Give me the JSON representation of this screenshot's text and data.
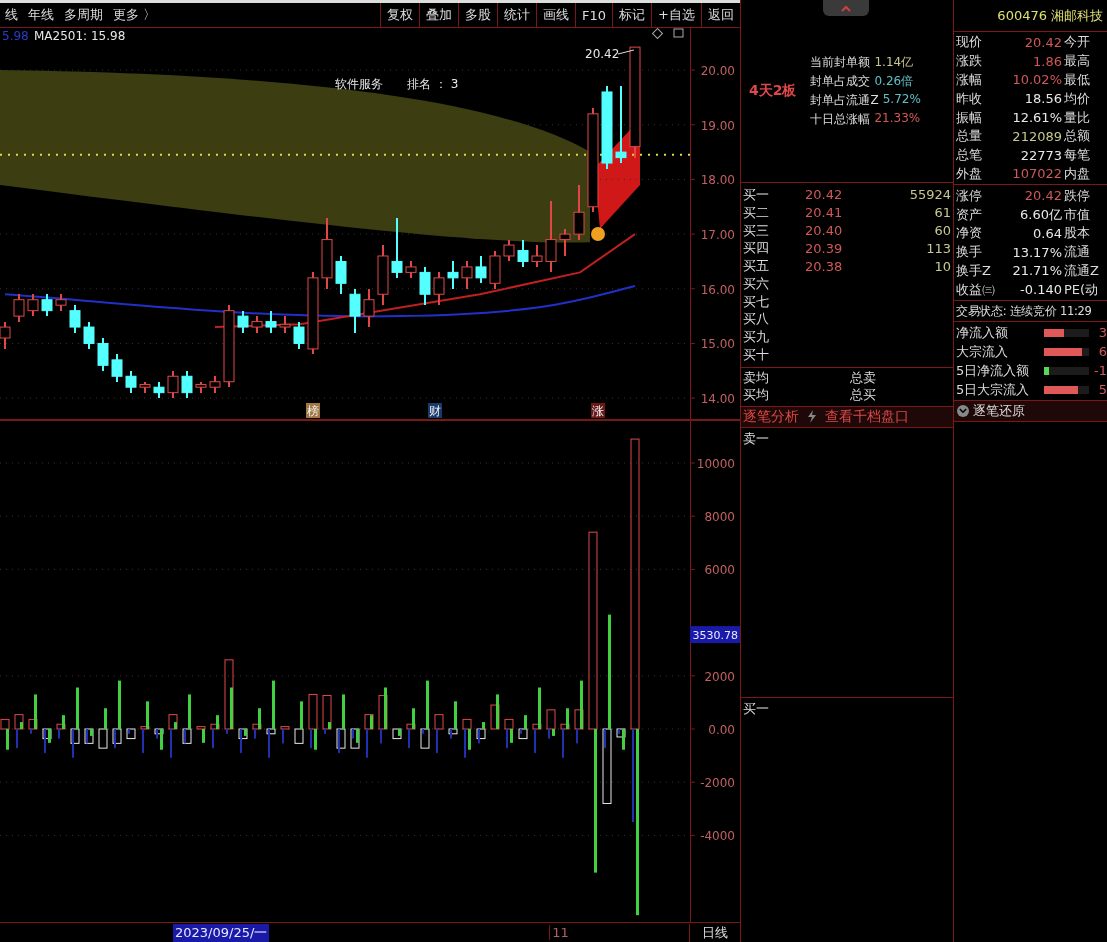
{
  "toolbar": {
    "left": [
      "线",
      "年线",
      "多周期",
      "更多 〉"
    ],
    "right": [
      "复权",
      "叠加",
      "多股",
      "统计",
      "画线",
      "F10",
      "标记",
      "+自选",
      "返回"
    ]
  },
  "price_chart": {
    "legend": [
      {
        "text": "5.98",
        "color": "#2a3cc8"
      },
      {
        "text": "MA2501: 15.98",
        "color": "#e8e8e8"
      }
    ],
    "sector_label": "软件服务",
    "rank_label": "排名 ： 3",
    "last_price_tag": "20.42",
    "chart_data": {
      "type": "candlestick",
      "ylim": [
        13.6,
        20.77
      ],
      "grid": true,
      "ohlc": [
        [
          15.1,
          15.4,
          14.9,
          15.3
        ],
        [
          15.5,
          15.9,
          15.4,
          15.8
        ],
        [
          15.6,
          15.9,
          15.5,
          15.8
        ],
        [
          15.8,
          15.9,
          15.5,
          15.6
        ],
        [
          15.7,
          15.9,
          15.6,
          15.8
        ],
        [
          15.6,
          15.7,
          15.2,
          15.3
        ],
        [
          15.3,
          15.4,
          14.9,
          15.0
        ],
        [
          15.0,
          15.1,
          14.5,
          14.6
        ],
        [
          14.7,
          14.8,
          14.3,
          14.4
        ],
        [
          14.4,
          14.5,
          14.1,
          14.2
        ],
        [
          14.2,
          14.3,
          14.1,
          14.25
        ],
        [
          14.2,
          14.3,
          14.0,
          14.1
        ],
        [
          14.1,
          14.5,
          14.0,
          14.4
        ],
        [
          14.4,
          14.5,
          14.0,
          14.1
        ],
        [
          14.2,
          14.3,
          14.1,
          14.25
        ],
        [
          14.2,
          14.4,
          14.1,
          14.3
        ],
        [
          14.3,
          15.7,
          14.2,
          15.6
        ],
        [
          15.5,
          15.6,
          15.2,
          15.3
        ],
        [
          15.3,
          15.5,
          15.2,
          15.4
        ],
        [
          15.4,
          15.6,
          15.2,
          15.3
        ],
        [
          15.3,
          15.5,
          15.2,
          15.35
        ],
        [
          15.3,
          15.4,
          14.9,
          15.0
        ],
        [
          14.9,
          16.3,
          14.8,
          16.2
        ],
        [
          16.2,
          17.3,
          16.0,
          16.9
        ],
        [
          16.5,
          16.6,
          15.9,
          16.1
        ],
        [
          15.9,
          16.0,
          15.2,
          15.5
        ],
        [
          15.5,
          16.0,
          15.3,
          15.8
        ],
        [
          15.9,
          16.8,
          15.7,
          16.6
        ],
        [
          16.5,
          17.3,
          16.2,
          16.3
        ],
        [
          16.3,
          16.5,
          16.2,
          16.4
        ],
        [
          16.3,
          16.4,
          15.7,
          15.9
        ],
        [
          15.9,
          16.3,
          15.7,
          16.2
        ],
        [
          16.3,
          16.5,
          16.0,
          16.2
        ],
        [
          16.2,
          16.5,
          16.0,
          16.4
        ],
        [
          16.4,
          16.6,
          16.1,
          16.2
        ],
        [
          16.1,
          16.7,
          16.0,
          16.6
        ],
        [
          16.6,
          16.9,
          16.5,
          16.8
        ],
        [
          16.7,
          16.9,
          16.4,
          16.5
        ],
        [
          16.5,
          16.8,
          16.4,
          16.6
        ],
        [
          16.5,
          17.6,
          16.3,
          16.9
        ],
        [
          16.9,
          17.1,
          16.6,
          17.0
        ],
        [
          17.0,
          17.9,
          16.9,
          17.4
        ],
        [
          17.5,
          19.3,
          17.4,
          19.2
        ],
        [
          19.6,
          19.7,
          18.2,
          18.3
        ],
        [
          18.5,
          19.7,
          18.3,
          18.4
        ],
        [
          18.6,
          20.42,
          18.4,
          20.42
        ]
      ],
      "yticks": [
        {
          "value": 20,
          "label": "20.00"
        },
        {
          "value": 19,
          "label": "19.00"
        },
        {
          "value": 18,
          "label": "18.00"
        },
        {
          "value": 17,
          "label": "17.00"
        },
        {
          "value": 16,
          "label": "16.00"
        },
        {
          "value": 15,
          "label": "15.00"
        },
        {
          "value": 14,
          "label": "14.00"
        }
      ]
    },
    "markers": [
      {
        "text": "榜",
        "color": "#a07840"
      },
      {
        "text": "财",
        "color": "#183a6a"
      },
      {
        "text": "涨",
        "color": "#6a1818"
      }
    ]
  },
  "indicator_chart": {
    "cursor_value": "3530.78",
    "chart_data": {
      "type": "bar",
      "ylim": [
        -7256,
        11617
      ],
      "grid": true,
      "series": [
        {
          "color": "#e04848",
          "values": [
            360,
            540,
            360,
            null,
            180,
            null,
            null,
            null,
            null,
            null,
            90,
            null,
            540,
            null,
            90,
            180,
            2600,
            null,
            180,
            null,
            90,
            null,
            1300,
            1260,
            null,
            null,
            540,
            1260,
            null,
            180,
            null,
            540,
            null,
            360,
            null,
            900,
            360,
            null,
            180,
            720,
            180,
            720,
            7400,
            null,
            null,
            10900
          ]
        },
        {
          "color": "#e8e8e8",
          "values": [
            null,
            null,
            null,
            -360,
            null,
            -540,
            -540,
            -720,
            -540,
            -360,
            null,
            -180,
            null,
            -540,
            null,
            null,
            null,
            -360,
            null,
            -180,
            null,
            -540,
            null,
            null,
            -720,
            -720,
            null,
            null,
            -360,
            null,
            -720,
            null,
            -180,
            null,
            -360,
            null,
            null,
            -360,
            null,
            null,
            null,
            null,
            null,
            -2800,
            -300,
            null
          ]
        },
        {
          "color": "#40d040",
          "values": [
            -780,
            260,
            1300,
            -520,
            520,
            1560,
            -260,
            780,
            1820,
            0,
            1040,
            -780,
            260,
            1300,
            -520,
            520,
            1560,
            -260,
            780,
            1820,
            0,
            1040,
            -780,
            260,
            1300,
            -520,
            520,
            1560,
            -260,
            780,
            1820,
            0,
            1040,
            -780,
            260,
            1300,
            -520,
            520,
            1560,
            -260,
            780,
            1820,
            -5400,
            4300,
            -780,
            -7000
          ]
        },
        {
          "color": "#2030b0",
          "values": [
            0,
            -720,
            -180,
            -900,
            -360,
            -1080,
            -540,
            0,
            -720,
            -180,
            -900,
            -360,
            -1080,
            -540,
            0,
            -720,
            -180,
            -900,
            -360,
            -1080,
            -540,
            0,
            -720,
            -180,
            -900,
            -360,
            -1080,
            -540,
            0,
            -720,
            -180,
            -900,
            -360,
            -1080,
            -540,
            0,
            -720,
            -180,
            -900,
            -360,
            -1080,
            -540,
            0,
            -720,
            -180,
            -3500
          ]
        }
      ],
      "yticks": [
        {
          "value": 10000,
          "label": "10000"
        },
        {
          "value": 8000,
          "label": "8000"
        },
        {
          "value": 6000,
          "label": "6000"
        },
        {
          "value": 2000,
          "label": "2000"
        },
        {
          "value": 0,
          "label": "0.00"
        },
        {
          "value": -2000,
          "label": "-2000"
        },
        {
          "value": -4000,
          "label": "-4000"
        }
      ]
    }
  },
  "bottom_bar": {
    "date": "2023/09/25/一",
    "tick": "11",
    "period": "日线"
  },
  "seal": {
    "badge": "4天2板",
    "rows": [
      {
        "label": "当前封单额",
        "value": "1.14亿",
        "color": "#c8c890"
      },
      {
        "label": "封单占成交",
        "value": "0.26倍",
        "color": "#60c0c8"
      },
      {
        "label": "封单占流通Z",
        "value": "5.72%",
        "color": "#60c0c8"
      },
      {
        "label": "十日总涨幅",
        "value": "21.33%",
        "color": "#d05858"
      }
    ]
  },
  "order_book": {
    "bids": [
      {
        "label": "买一",
        "price": "20.42",
        "volume": "55924"
      },
      {
        "label": "买二",
        "price": "20.41",
        "volume": "61"
      },
      {
        "label": "买三",
        "price": "20.40",
        "volume": "60"
      },
      {
        "label": "买四",
        "price": "20.39",
        "volume": "113"
      },
      {
        "label": "买五",
        "price": "20.38",
        "volume": "10"
      },
      {
        "label": "买六"
      },
      {
        "label": "买七"
      },
      {
        "label": "买八"
      },
      {
        "label": "买九"
      },
      {
        "label": "买十"
      }
    ],
    "summary": [
      {
        "label": "卖均",
        "label2": "总卖"
      },
      {
        "label": "买均",
        "label2": "总买"
      }
    ]
  },
  "tick_panel": {
    "tabs": [
      "逐笔分析",
      "查看千档盘口"
    ],
    "ask_label": "卖一",
    "bid_label": "买一"
  },
  "quote": {
    "code": "600476",
    "name": "湘邮科技",
    "price_rows": [
      {
        "label": "现价",
        "value": "20.42",
        "label2": "今开",
        "color": "#d05858"
      },
      {
        "label": "涨跌",
        "value": "1.86",
        "label2": "最高",
        "color": "#d05858"
      },
      {
        "label": "涨幅",
        "value": "10.02%",
        "label2": "最低",
        "color": "#d05858"
      },
      {
        "label": "昨收",
        "value": "18.56",
        "label2": "均价",
        "color": "#e8e8e8"
      },
      {
        "label": "振幅",
        "value": "12.61%",
        "label2": "量比",
        "color": "#e8e8e8"
      },
      {
        "label": "总量",
        "value": "212089",
        "label2": "总额",
        "color": "#c8c890"
      },
      {
        "label": "总笔",
        "value": "22773",
        "label2": "每笔",
        "color": "#e8e8e8"
      },
      {
        "label": "外盘",
        "value": "107022",
        "label2": "内盘",
        "color": "#d05858"
      }
    ],
    "fundamental_rows": [
      {
        "label": "涨停",
        "value": "20.42",
        "label2": "跌停",
        "color": "#d05858"
      },
      {
        "label": "资产",
        "value": "6.60亿",
        "label2": "市值",
        "color": "#e8e8e8"
      },
      {
        "label": "净资",
        "value": "0.64",
        "label2": "股本",
        "color": "#e8e8e8"
      },
      {
        "label": "换手",
        "value": "13.17%",
        "label2": "流通",
        "color": "#e8e8e8"
      },
      {
        "label": "换手Z",
        "value": "21.71%",
        "label2": "流通Z",
        "color": "#e8e8e8"
      },
      {
        "label": "收益㈢",
        "value": "-0.140",
        "label2": "PE(动",
        "color": "#e8e8e8"
      }
    ],
    "status": "交易状态: 连续竞价 11:29",
    "flows": [
      {
        "label": "净流入额",
        "value": "3",
        "color": "#e05858",
        "level": 0.45
      },
      {
        "label": "大宗流入",
        "value": "6",
        "color": "#e05858",
        "level": 0.85
      },
      {
        "label": "5日净流入额",
        "value": "-1",
        "color": "#58d858",
        "level": 0.12
      },
      {
        "label": "5日大宗流入",
        "value": "5",
        "color": "#e05858",
        "level": 0.75
      }
    ],
    "detail_label": "逐笔还原"
  }
}
